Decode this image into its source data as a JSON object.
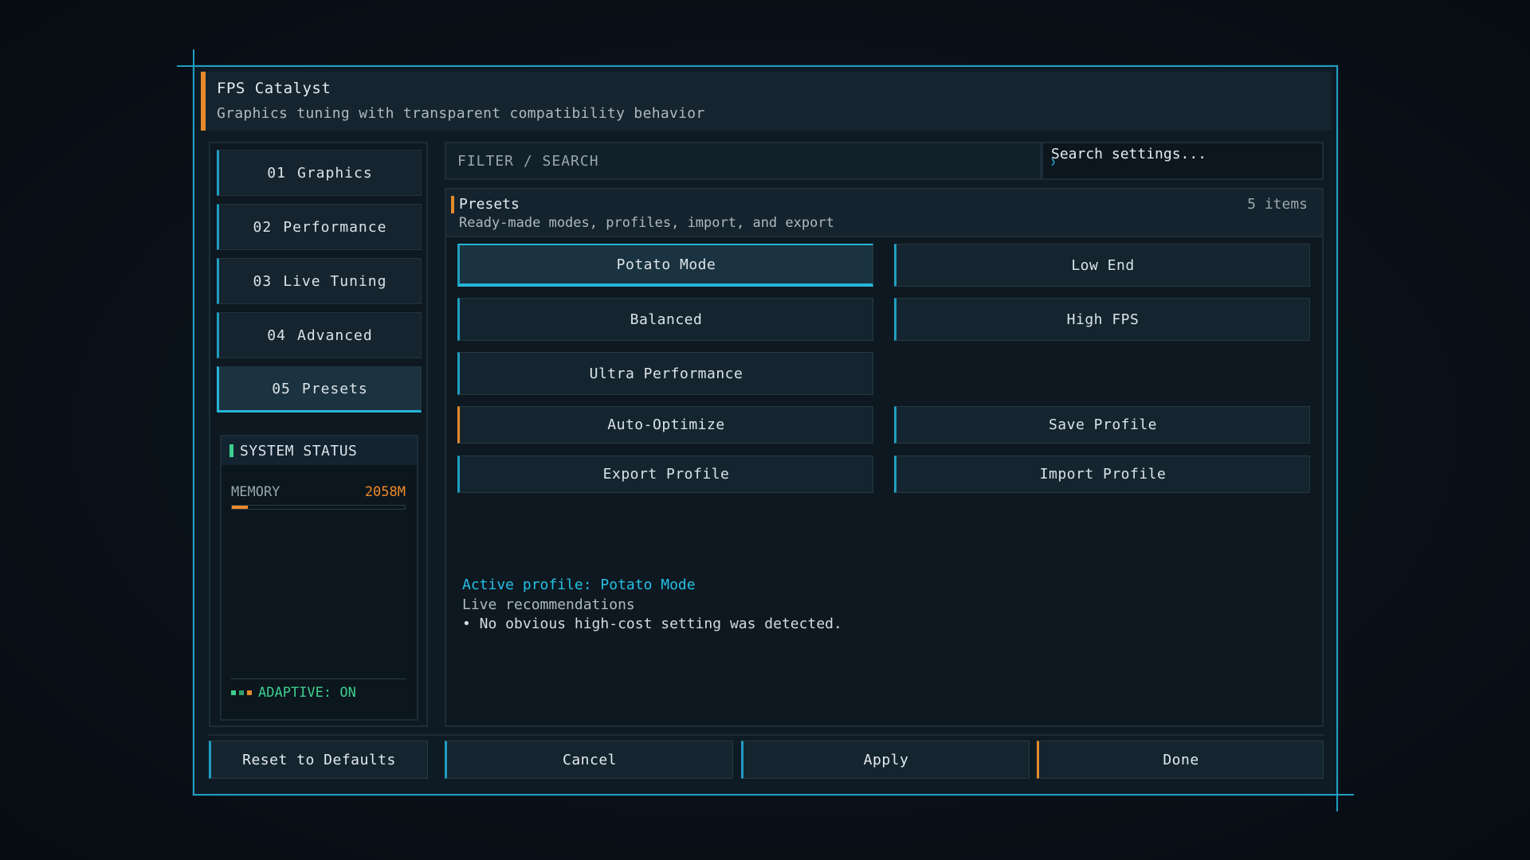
{
  "window": {
    "title": "FPS Catalyst",
    "subtitle": "Graphics tuning with transparent compatibility behavior"
  },
  "sidebar": {
    "items": [
      {
        "num": "01",
        "label": "Graphics"
      },
      {
        "num": "02",
        "label": "Performance"
      },
      {
        "num": "03",
        "label": "Live Tuning"
      },
      {
        "num": "04",
        "label": "Advanced"
      },
      {
        "num": "05",
        "label": "Presets"
      }
    ],
    "active_index": 4
  },
  "status": {
    "title": "SYSTEM STATUS",
    "memory_label": "MEMORY",
    "memory_value": "2058M",
    "memory_fraction": 0.09,
    "adaptive": "ADAPTIVE: ON"
  },
  "filter": {
    "label": "FILTER / SEARCH",
    "placeholder": "Search settings..."
  },
  "section": {
    "title": "Presets",
    "subtitle": "Ready-made modes, profiles, import, and export",
    "count": "5 items"
  },
  "presets": {
    "potato": "Potato Mode",
    "low_end": "Low End",
    "balanced": "Balanced",
    "high_fps": "High FPS",
    "ultra": "Ultra Performance",
    "auto_optimize": "Auto-Optimize",
    "save_profile": "Save Profile",
    "export_profile": "Export Profile",
    "import_profile": "Import Profile"
  },
  "info": {
    "active_profile": "Active profile: Potato Mode",
    "live_title": "Live recommendations",
    "recommendation": "• No obvious high-cost setting was detected."
  },
  "footer": {
    "reset": "Reset to Defaults",
    "cancel": "Cancel",
    "apply": "Apply",
    "done": "Done"
  },
  "colors": {
    "accent": "#1f9ec0",
    "highlight": "#e58a2c",
    "ok": "#3ecf8e"
  }
}
